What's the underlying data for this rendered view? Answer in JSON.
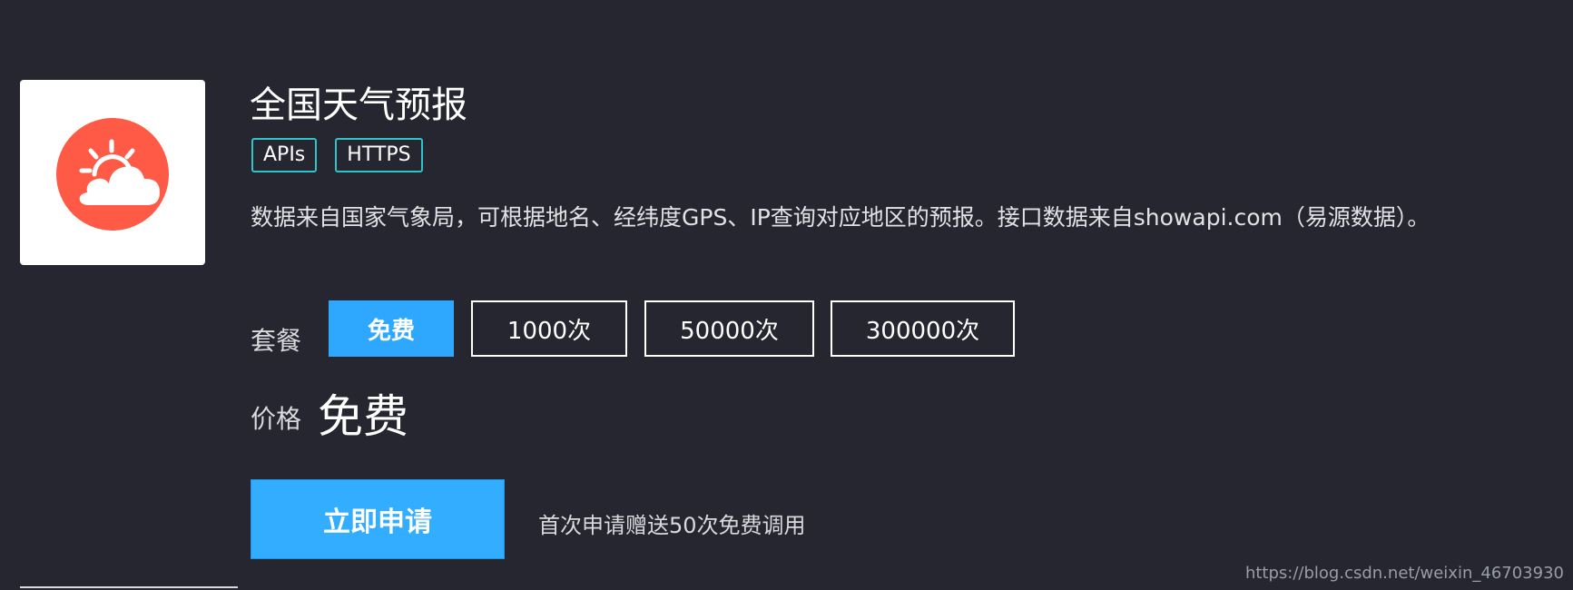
{
  "api": {
    "title": "全国天气预报",
    "tags": [
      "APIs",
      "HTTPS"
    ],
    "description": "数据来自国家气象局，可根据地名、经纬度GPS、IP查询对应地区的预报。接口数据来自showapi.com（易源数据）。",
    "logo_icon": "sun-cloud-icon",
    "logo_color": "#ff5a45"
  },
  "plans": {
    "label": "套餐",
    "options": [
      "免费",
      "1000次",
      "50000次",
      "300000次"
    ],
    "selected": "免费",
    "accent_color": "#2ea8ff"
  },
  "price": {
    "label": "价格",
    "value": "免费"
  },
  "apply": {
    "button_label": "立即申请",
    "note": "首次申请赠送50次免费调用"
  },
  "watermark": "https://blog.csdn.net/weixin_46703930"
}
